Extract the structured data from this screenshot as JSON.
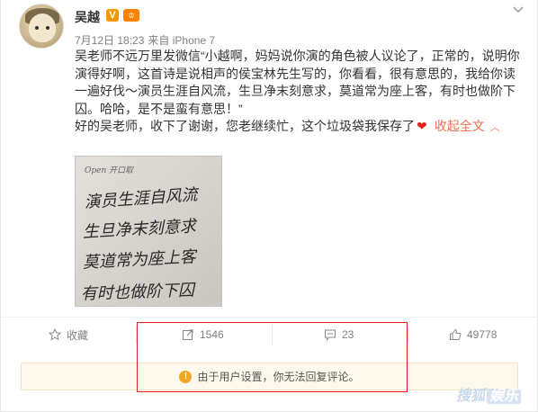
{
  "post": {
    "author": "吴越",
    "verified_badge": "V",
    "level_badge": "♔",
    "date": "7月12日 18:23",
    "source": "来自 iPhone 7",
    "paragraph1": "吴老师不远万里发微信“小越啊，妈妈说你演的角色被人议论了，正常的，说明你演得好啊，这首诗是说相声的侯宝林先生写的，你看看，很有意思的，我给你读一遍好伐～演员生涯自风流，生旦净末刻意求，莫道常为座上客，有时也做阶下囚。哈哈，是不是蛮有意思！”",
    "paragraph2": "好的吴老师，收下了谢谢，您老继续忙，这个垃圾袋我保存了",
    "heart": "❤",
    "collapse_label": "收起全文",
    "collapse_caret": "︿",
    "photo_handwriting": [
      "Open 开口取",
      "演员生涯自风流",
      "生旦净末刻意求",
      "莫道常为座上客",
      "有时也做阶下囚"
    ]
  },
  "actions": {
    "favorite_label": "收藏",
    "repost_count": "1546",
    "comment_count": "23",
    "like_count": "49778"
  },
  "notice": {
    "icon": "!",
    "text": "由于用户设置，你无法回复评论。"
  },
  "watermark": {
    "text1": "搜狐",
    "text2": "娱乐"
  },
  "colors": {
    "link_orange": "#eb7350",
    "heart_red": "#e0251b",
    "highlight_red": "#e02020",
    "notice_bg": "#fdf8ec"
  }
}
